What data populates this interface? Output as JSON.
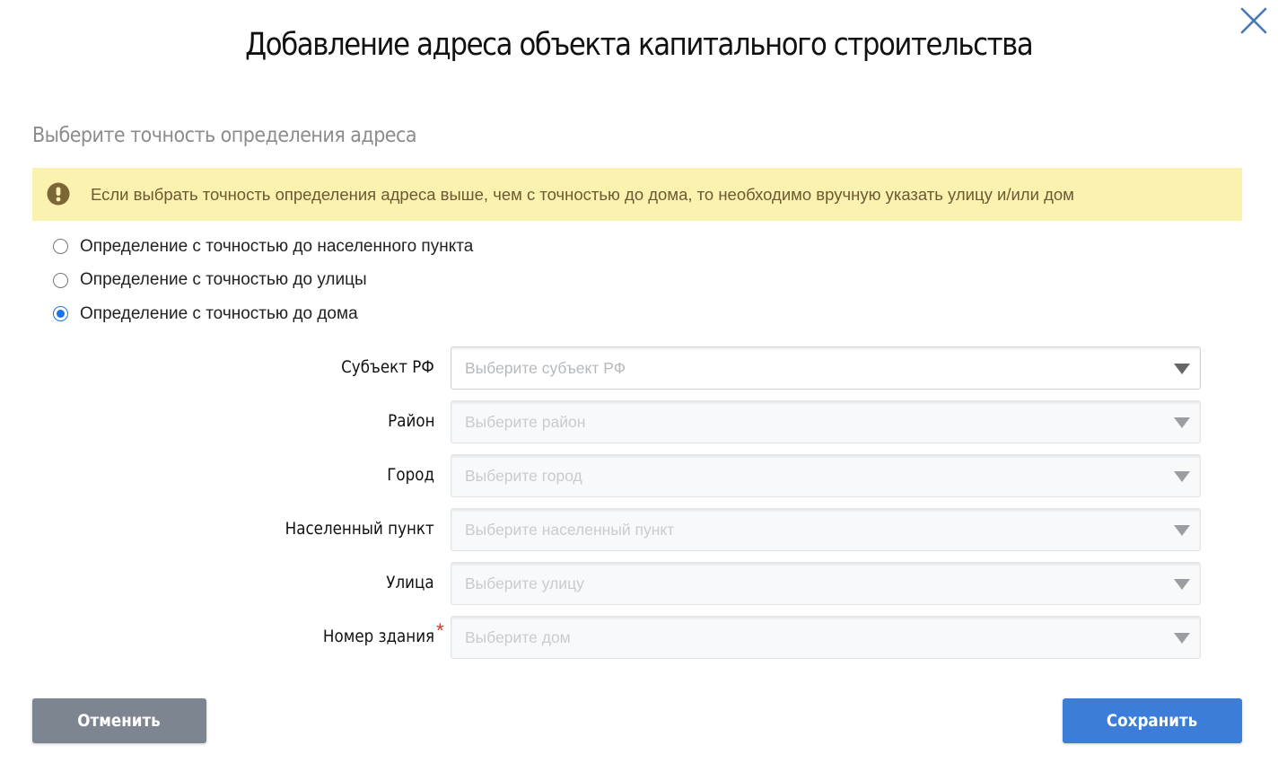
{
  "dialog": {
    "title": "Добавление адреса объекта капитального строительства",
    "subtitle": "Выберите точность определения адреса"
  },
  "warning": {
    "text": "Если выбрать точность определения адреса выше, чем с точностью до дома, то необходимо вручную указать улицу и/или дом"
  },
  "precision_options": [
    {
      "label": "Определение с точностью до населенного пункта",
      "checked": false
    },
    {
      "label": "Определение с точностью до улицы",
      "checked": false
    },
    {
      "label": "Определение с точностью до дома",
      "checked": true
    }
  ],
  "fields": [
    {
      "label": "Субъект РФ",
      "placeholder": "Выберите субъект РФ",
      "enabled": true
    },
    {
      "label": "Район",
      "placeholder": "Выберите район",
      "enabled": false
    },
    {
      "label": "Город",
      "placeholder": "Выберите город",
      "enabled": false
    },
    {
      "label": "Населенный пункт",
      "placeholder": "Выберите населенный пункт",
      "enabled": false
    },
    {
      "label": "Улица",
      "placeholder": "Выберите улицу",
      "enabled": false
    },
    {
      "label": "Номер здания",
      "placeholder": "Выберите дом",
      "enabled": false,
      "required_mark": "*"
    }
  ],
  "buttons": {
    "cancel_label": "Отменить",
    "save_label": "Сохранить"
  },
  "colors": {
    "primary": "#3b7dd8",
    "secondary": "#7d8690",
    "warning_bg": "#fbf2b0",
    "warning_icon": "#7a6735",
    "required": "#d9302c",
    "radio_checked": "#1a73e8"
  },
  "icons": {
    "close": "close-icon",
    "warning": "exclamation-circle-icon",
    "dropdown": "chevron-down-icon"
  }
}
